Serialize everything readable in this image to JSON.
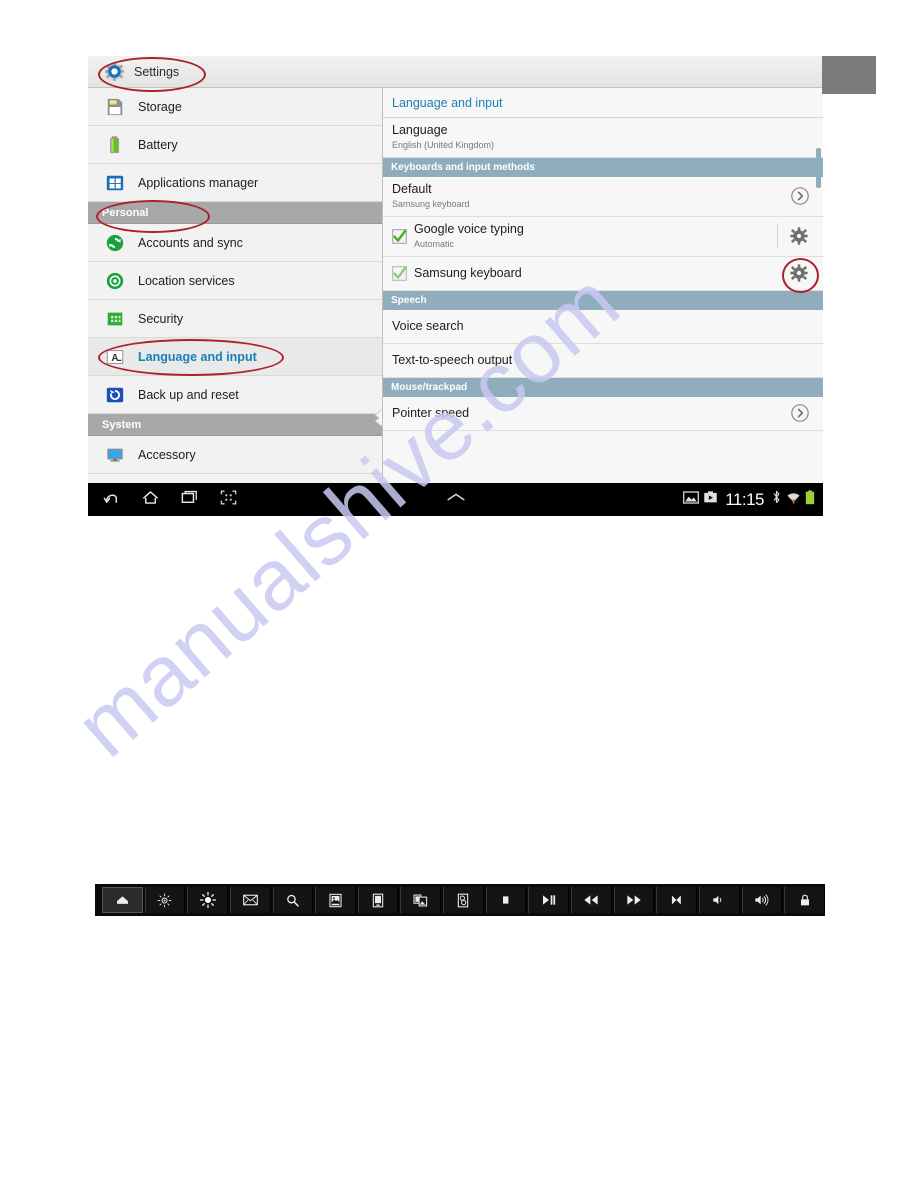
{
  "page": {
    "watermark": "manualshive.com"
  },
  "tablet": {
    "header": {
      "icon": "settings-gear-icon",
      "title": "Settings"
    },
    "sidebar": {
      "items": [
        {
          "type": "item",
          "icon": "storage-card-icon",
          "label": "Storage",
          "selected": false
        },
        {
          "type": "item",
          "icon": "battery-icon",
          "label": "Battery",
          "selected": false
        },
        {
          "type": "item",
          "icon": "applications-grid-icon",
          "label": "Applications manager",
          "selected": false
        },
        {
          "type": "section",
          "label": "Personal"
        },
        {
          "type": "item",
          "icon": "sync-accounts-icon",
          "label": "Accounts and sync",
          "selected": false
        },
        {
          "type": "item",
          "icon": "location-target-icon",
          "label": "Location services",
          "selected": false
        },
        {
          "type": "item",
          "icon": "security-lock-icon",
          "label": "Security",
          "selected": false
        },
        {
          "type": "item",
          "icon": "language-a-icon",
          "label": "Language and input",
          "selected": true
        },
        {
          "type": "item",
          "icon": "backup-reset-icon",
          "label": "Back up and reset",
          "selected": false
        },
        {
          "type": "section",
          "label": "System"
        },
        {
          "type": "item",
          "icon": "accessory-monitor-icon",
          "label": "Accessory",
          "selected": false
        }
      ]
    },
    "content": {
      "title": "Language and input",
      "rows": [
        {
          "type": "row",
          "name": "language",
          "title": "Language",
          "subtitle": "English (United Kingdom)",
          "chevron": false,
          "checkbox": null,
          "gear": false
        },
        {
          "type": "section",
          "name": "keyboards-section",
          "label": "Keyboards and input methods"
        },
        {
          "type": "row",
          "name": "default-keyboard",
          "title": "Default",
          "subtitle": "Samsung keyboard",
          "chevron": true,
          "checkbox": null,
          "gear": false
        },
        {
          "type": "row",
          "name": "google-voice-typing",
          "title": "Google voice typing",
          "subtitle": "Automatic",
          "chevron": false,
          "checkbox": "checked",
          "gear": true
        },
        {
          "type": "row",
          "name": "samsung-keyboard",
          "title": "Samsung keyboard",
          "subtitle": "",
          "chevron": false,
          "checkbox": "checked",
          "gear": true
        },
        {
          "type": "section",
          "name": "speech-section",
          "label": "Speech"
        },
        {
          "type": "row",
          "name": "voice-search",
          "title": "Voice search",
          "subtitle": "",
          "chevron": false,
          "checkbox": null,
          "gear": false
        },
        {
          "type": "row",
          "name": "text-to-speech",
          "title": "Text-to-speech output",
          "subtitle": "",
          "chevron": false,
          "checkbox": null,
          "gear": false
        },
        {
          "type": "section",
          "name": "mouse-section",
          "label": "Mouse/trackpad"
        },
        {
          "type": "row",
          "name": "pointer-speed",
          "title": "Pointer speed",
          "subtitle": "",
          "chevron": true,
          "checkbox": null,
          "gear": false
        }
      ]
    },
    "navbar": {
      "back_label": "back-icon",
      "home_label": "home-icon",
      "recents_label": "recents-icon",
      "screenshot_label": "screen-capture-icon",
      "expand_label": "chevron-up-icon",
      "clock": "11:15",
      "status_icons": [
        "image-icon",
        "screenshot-capture-icon",
        "bluetooth-icon",
        "wifi-icon",
        "battery-icon"
      ]
    }
  },
  "toolbar": {
    "buttons": [
      {
        "name": "home-button",
        "icon": "home-icon",
        "active": true
      },
      {
        "name": "brightness-down-button",
        "icon": "brightness-low-icon",
        "active": false
      },
      {
        "name": "brightness-up-button",
        "icon": "brightness-high-icon",
        "active": false
      },
      {
        "name": "mail-button",
        "icon": "envelope-icon",
        "active": false
      },
      {
        "name": "search-button",
        "icon": "magnifier-icon",
        "active": false
      },
      {
        "name": "gallery-button",
        "icon": "picture-frame-icon",
        "active": false
      },
      {
        "name": "document-button",
        "icon": "document-icon",
        "active": false
      },
      {
        "name": "multi-window-button",
        "icon": "windows-stack-icon",
        "active": false
      },
      {
        "name": "media-button",
        "icon": "media-page-icon",
        "active": false
      },
      {
        "name": "stop-button",
        "icon": "stop-icon",
        "active": false
      },
      {
        "name": "play-pause-button",
        "icon": "play-pause-icon",
        "active": false
      },
      {
        "name": "rewind-button",
        "icon": "rewind-icon",
        "active": false
      },
      {
        "name": "fast-forward-button",
        "icon": "fast-forward-icon",
        "active": false
      },
      {
        "name": "mute-button",
        "icon": "mute-icon",
        "active": false
      },
      {
        "name": "volume-down-button",
        "icon": "volume-low-icon",
        "active": false
      },
      {
        "name": "volume-up-button",
        "icon": "volume-high-icon",
        "active": false
      },
      {
        "name": "lock-button",
        "icon": "padlock-icon",
        "active": false
      }
    ]
  },
  "annotations": [
    {
      "name": "annotation-settings",
      "shape": "ellipse",
      "color": "#b02029",
      "targets": "Settings"
    },
    {
      "name": "annotation-personal",
      "shape": "ellipse",
      "color": "#b02029",
      "targets": "Personal"
    },
    {
      "name": "annotation-language-input",
      "shape": "ellipse",
      "color": "#b02029",
      "targets": "Language and input"
    },
    {
      "name": "annotation-keyboard-gear",
      "shape": "ellipse",
      "color": "#b02029",
      "targets": "Samsung keyboard settings"
    }
  ],
  "colors": {
    "accent_blue": "#1a7fb5",
    "section_gray": "#a8a8a8",
    "section_blue": "#8fadbd",
    "annotation_red": "#b02029",
    "watermark": "#c9c9f2"
  }
}
